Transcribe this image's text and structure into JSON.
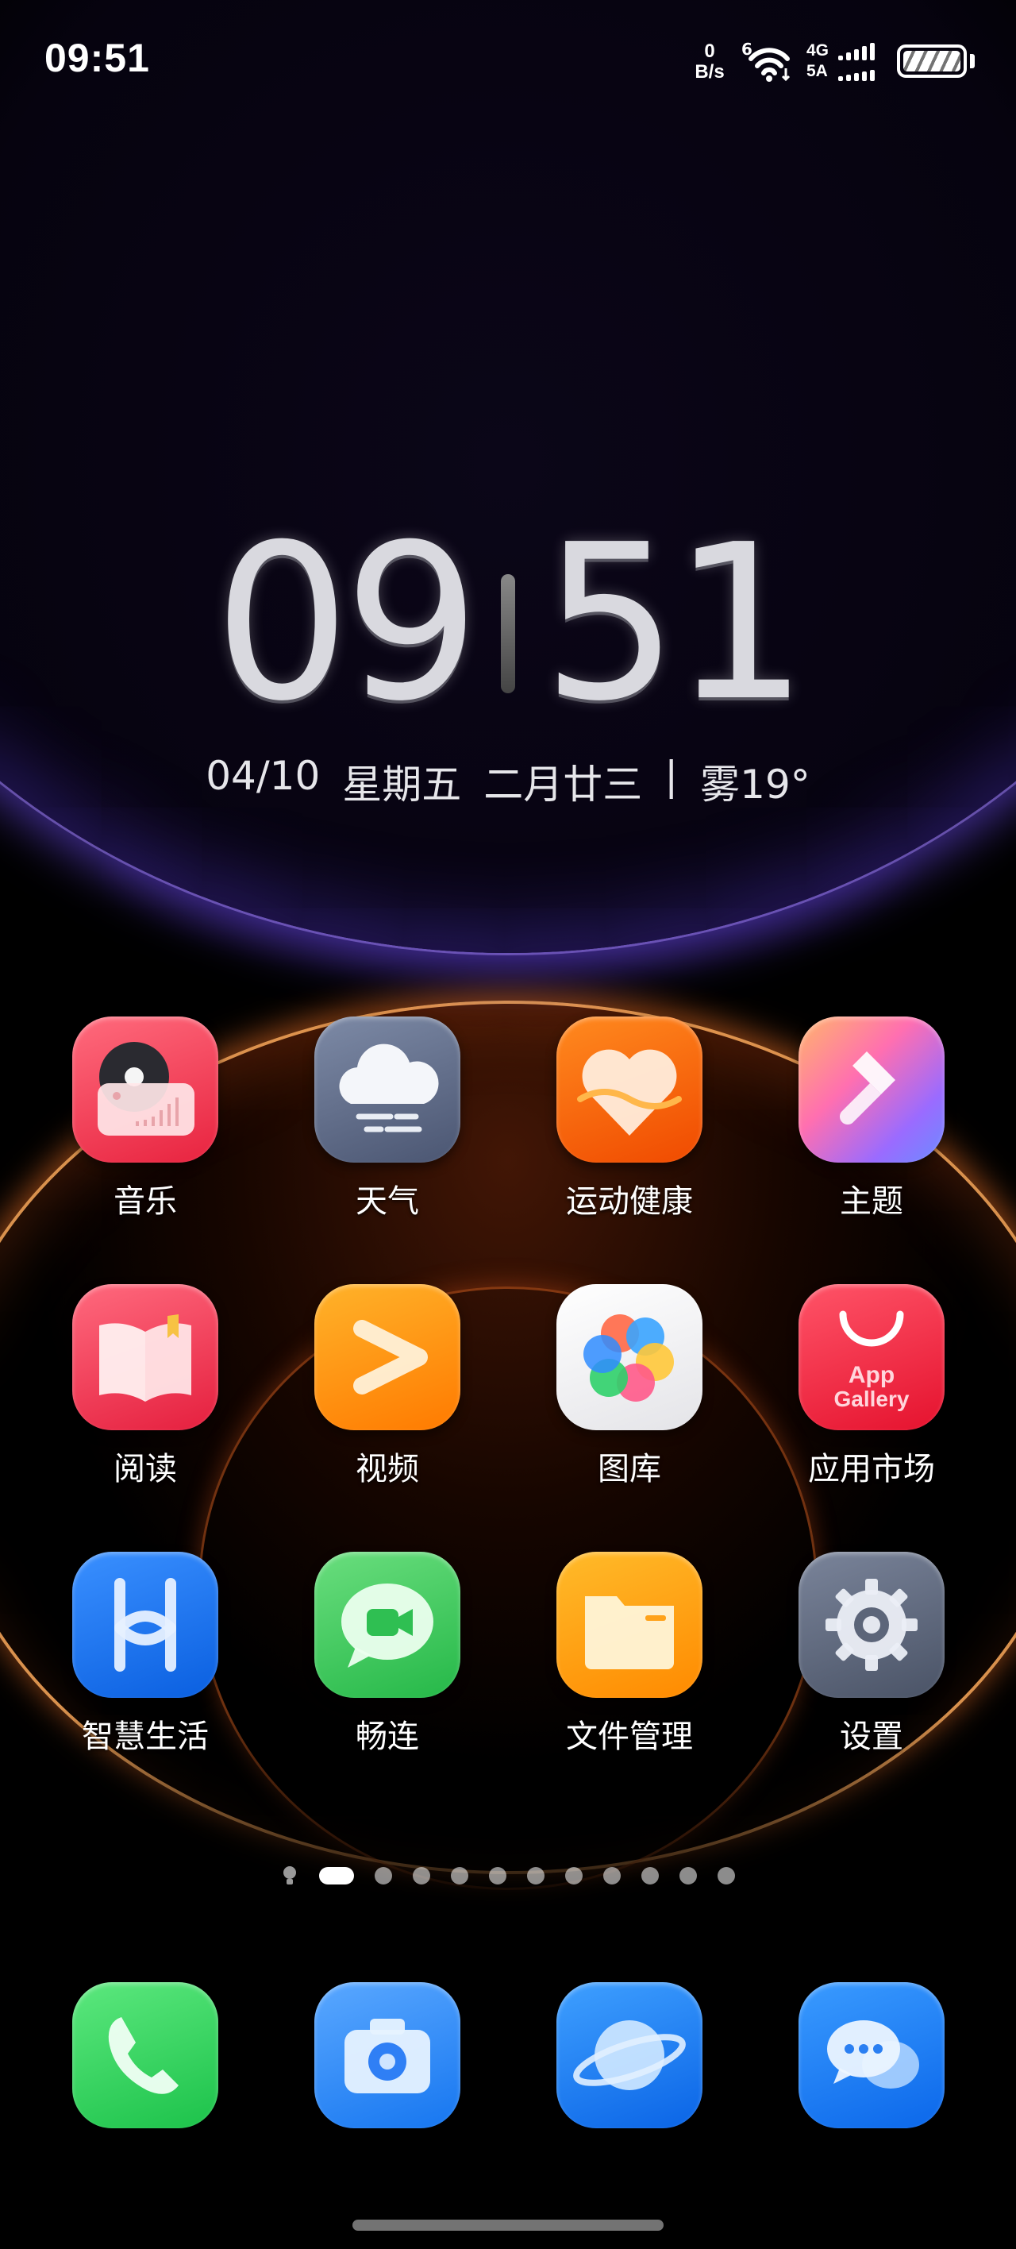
{
  "status_bar": {
    "time": "09:51",
    "net_speed_value": "0",
    "net_speed_unit": "B/s",
    "wifi_badge": "6",
    "sim1_label": "4G",
    "sim2_label": "5A"
  },
  "clock": {
    "hours": "09",
    "minutes": "51",
    "date": "04/10",
    "weekday": "星期五",
    "lunar": "二月廿三",
    "divider": "|",
    "weather": "雾19°"
  },
  "apps": [
    {
      "label": "音乐",
      "icon": "music-icon",
      "color": "#f0435a"
    },
    {
      "label": "天气",
      "icon": "weather-icon",
      "color": "#5f6f8e"
    },
    {
      "label": "运动健康",
      "icon": "health-icon",
      "color": "#ff6a00"
    },
    {
      "label": "主题",
      "icon": "themes-icon",
      "color": "#b08cff"
    },
    {
      "label": "阅读",
      "icon": "books-icon",
      "color": "#f23b55"
    },
    {
      "label": "视频",
      "icon": "video-icon",
      "color": "#ff9a00"
    },
    {
      "label": "图库",
      "icon": "gallery-icon",
      "color": "#f2f2f4"
    },
    {
      "label": "应用市场",
      "icon": "appgallery-icon",
      "color": "#f2253f",
      "icon_text_1": "App",
      "icon_text_2": "Gallery"
    },
    {
      "label": "智慧生活",
      "icon": "ai-life-icon",
      "color": "#1e74f0"
    },
    {
      "label": "畅连",
      "icon": "meetime-icon",
      "color": "#3cc85a"
    },
    {
      "label": "文件管理",
      "icon": "files-icon",
      "color": "#ff9d00"
    },
    {
      "label": "设置",
      "icon": "settings-icon",
      "color": "#5a6478"
    }
  ],
  "dock": [
    {
      "icon": "phone-icon",
      "color": "#2ed158"
    },
    {
      "icon": "camera-icon",
      "color": "#2d8cff"
    },
    {
      "icon": "browser-icon",
      "color": "#1f7cf2"
    },
    {
      "icon": "messages-icon",
      "color": "#1a7ff5"
    }
  ],
  "page_indicator": {
    "pages": 11,
    "current": 1
  }
}
